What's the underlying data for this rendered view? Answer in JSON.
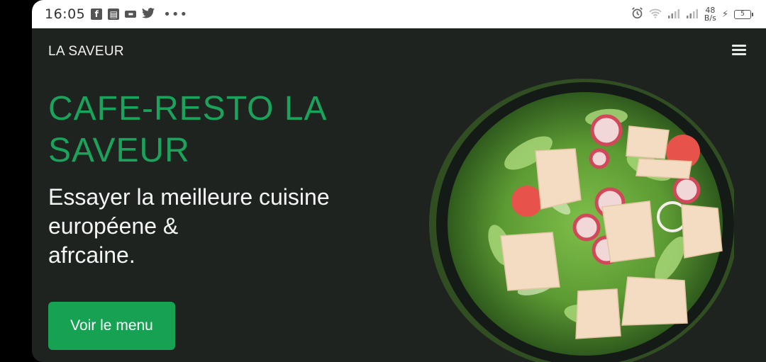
{
  "statusbar": {
    "time": "16:05",
    "notification_icons": [
      "facebook-icon",
      "news-icon",
      "message-icon",
      "twitter-icon"
    ],
    "more": "•••",
    "speed_value": "48",
    "speed_unit": "B/s",
    "battery_level": "5"
  },
  "nav": {
    "brand": "LA SAVEUR",
    "menu_icon": "hamburger-icon"
  },
  "hero": {
    "title_line1": "CAFE-RESTO LA",
    "title_line2": "SAVEUR",
    "subtitle_line1": "Essayer la meilleure cuisine",
    "subtitle_line2": "européene &",
    "subtitle_line3": "afrcaine.",
    "cta_label": "Voir le menu",
    "image": "salad-bowl-image"
  },
  "colors": {
    "background": "#1e2320",
    "accent": "#17a152",
    "title": "#1aa35a",
    "text": "#f4f4f4"
  }
}
